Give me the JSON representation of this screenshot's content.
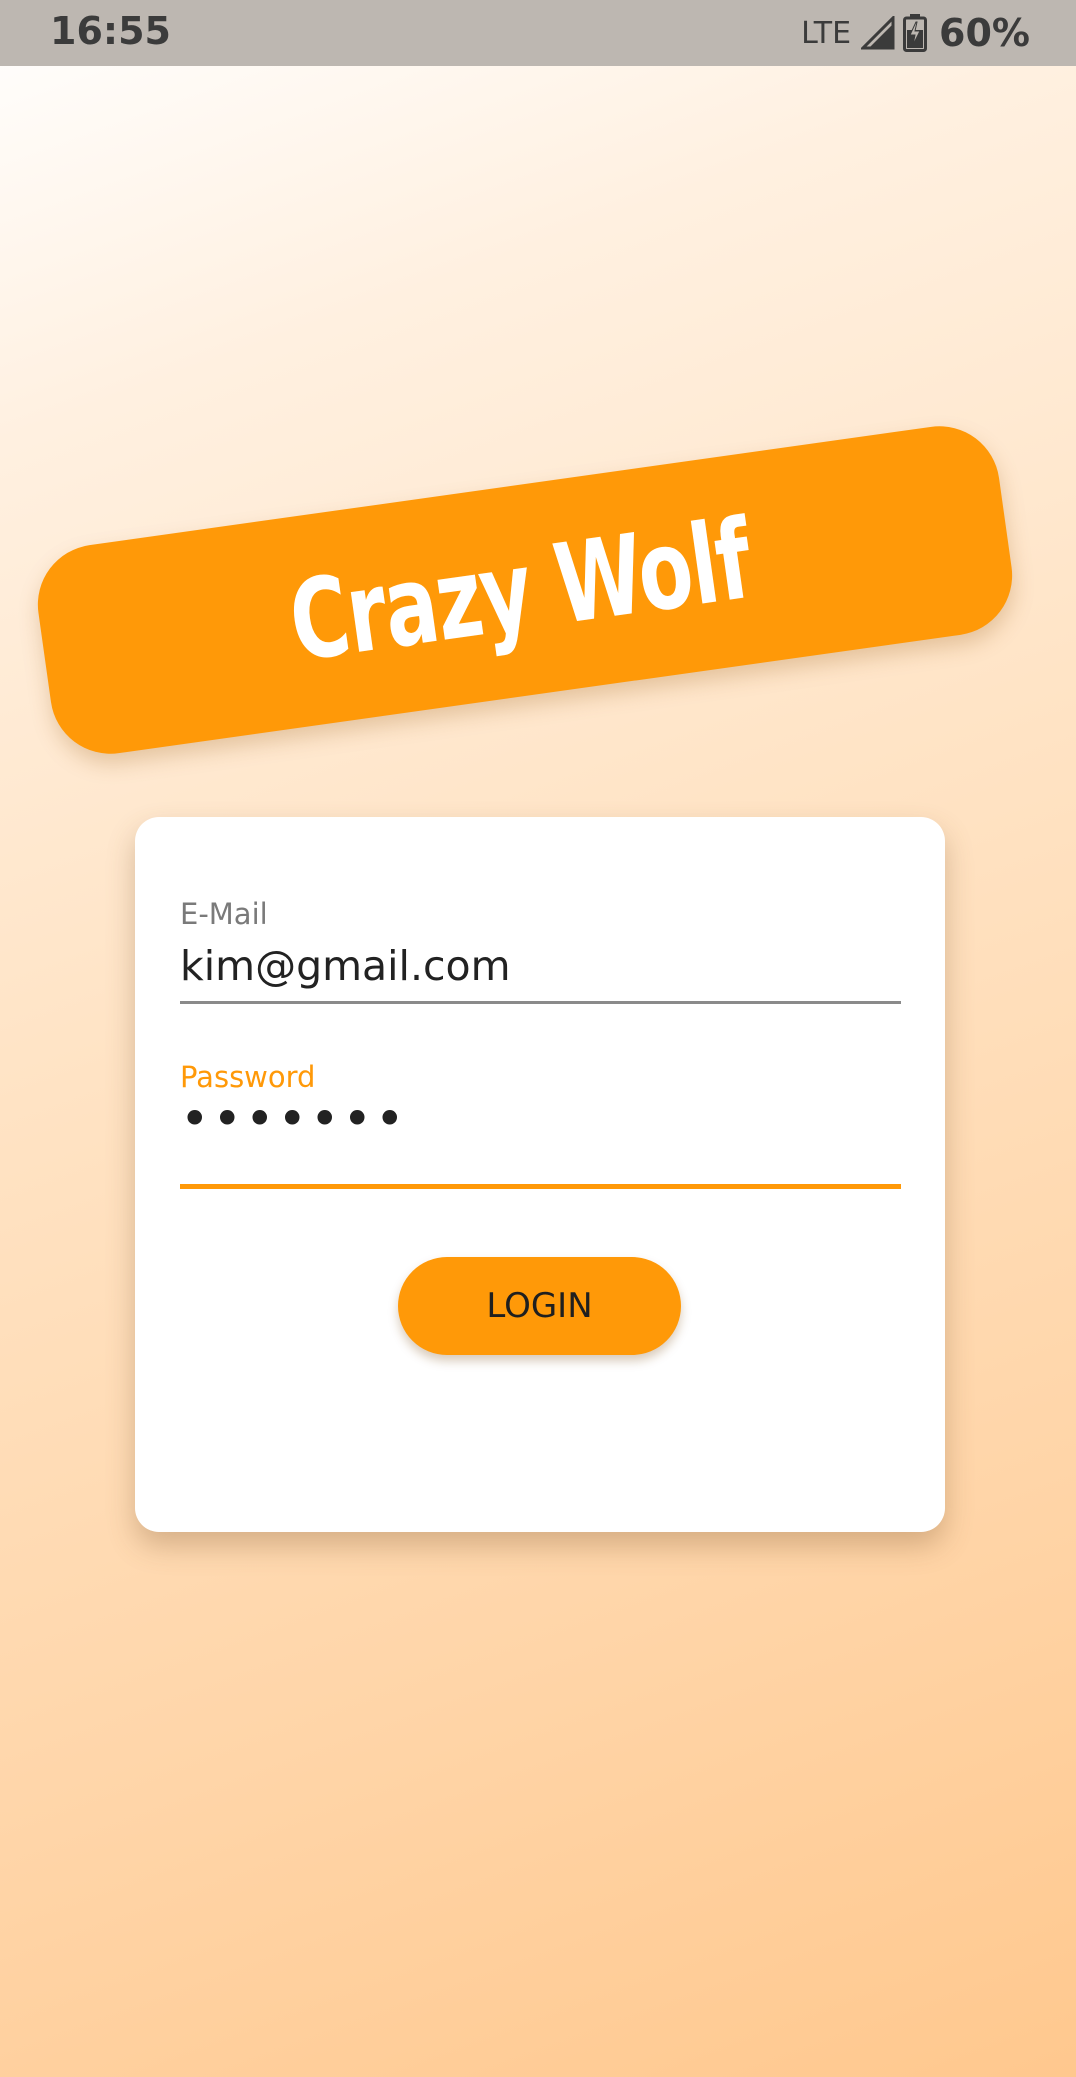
{
  "status_bar": {
    "time": "16:55",
    "network": "LTE",
    "battery_percent": "60%"
  },
  "banner": {
    "title": "Crazy Wolf"
  },
  "login_form": {
    "email_label": "E-Mail",
    "email_value": "kim@gmail.com",
    "password_label": "Password",
    "password_value": "•••••••",
    "login_button_label": "LOGIN"
  },
  "colors": {
    "accent": "#ff9908",
    "status_bar": "#bdb7b1",
    "card": "#ffffff"
  },
  "icons": {
    "signal": "signal-icon",
    "battery": "battery-charging-icon"
  }
}
